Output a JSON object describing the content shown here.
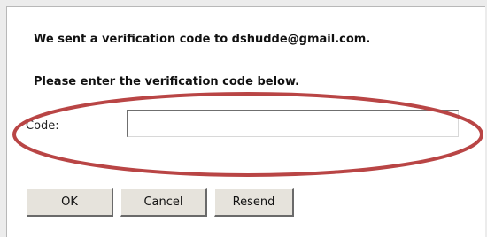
{
  "dialog": {
    "message_line1": "We sent a verification code to dshudde@gmail.com.",
    "message_line2": "Please enter the verification code below."
  },
  "code_field": {
    "label": "Code:",
    "value": "",
    "placeholder": ""
  },
  "buttons": {
    "ok_label": "OK",
    "cancel_label": "Cancel",
    "resend_label": "Resend"
  },
  "colors": {
    "highlight_oval": "#b94545",
    "background": "#ececec",
    "button_face": "#e6e3dc"
  }
}
